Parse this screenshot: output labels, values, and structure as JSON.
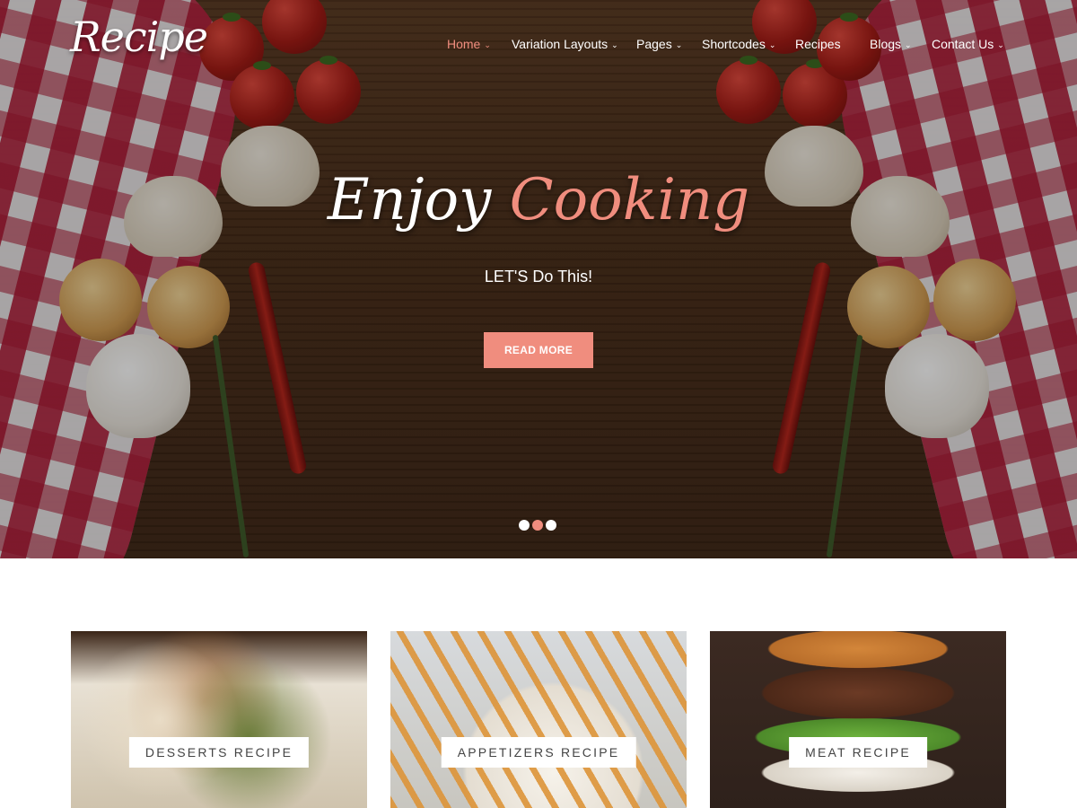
{
  "brand": {
    "logo": "Recipe"
  },
  "nav": {
    "items": [
      {
        "label": "Home",
        "chevron": "⌄"
      },
      {
        "label": "Variation Layouts",
        "chevron": "⌄"
      },
      {
        "label": "Pages",
        "chevron": "⌄"
      },
      {
        "label": "Shortcodes",
        "chevron": "⌄"
      },
      {
        "label": "Recipes",
        "chevron": ""
      },
      {
        "label": "Blogs",
        "chevron": "⌄"
      },
      {
        "label": "Contact Us",
        "chevron": "⌄"
      }
    ],
    "active": "Home"
  },
  "hero": {
    "title_part1": "Enjoy",
    "title_part2": "Cooking",
    "subtitle": "LET'S Do This!",
    "button": "READ MORE",
    "slides_total": 3,
    "active_slide": 2
  },
  "cards": [
    {
      "label": "DESSERTS RECIPE"
    },
    {
      "label": "APPETIZERS RECIPE"
    },
    {
      "label": "MEAT RECIPE"
    }
  ],
  "colors": {
    "accent": "#f08d7e",
    "text_light": "#ffffff"
  }
}
